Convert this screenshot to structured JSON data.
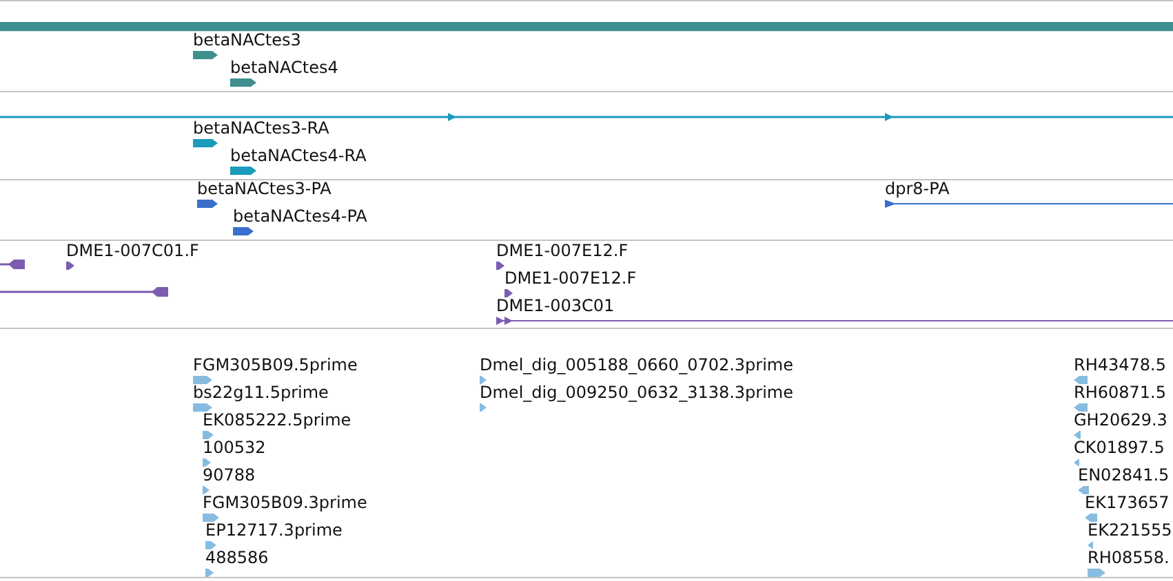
{
  "tracks": [
    {
      "color": "#3f8f8f",
      "features": [
        {
          "kind": "bar"
        },
        {
          "kind": "block",
          "label": "betaNACtes3",
          "reverse": false
        },
        {
          "kind": "block",
          "label": "betaNACtes4",
          "reverse": false
        }
      ]
    },
    {
      "color": "#1a9bbb",
      "features": [
        {
          "kind": "line",
          "reverse": false
        },
        {
          "kind": "block",
          "label": "betaNACtes3-RA",
          "reverse": false
        },
        {
          "kind": "block",
          "label": "betaNACtes4-RA",
          "reverse": false
        }
      ]
    },
    {
      "color": "#3a6fcc",
      "features": [
        {
          "kind": "block",
          "label": "betaNACtes3-PA",
          "reverse": false
        },
        {
          "kind": "block",
          "label": "betaNACtes4-PA",
          "reverse": false
        },
        {
          "kind": "block",
          "label": "dpr8-PA",
          "reverse": false
        }
      ]
    },
    {
      "color": "#7b5cb0",
      "features": [
        {
          "kind": "line",
          "reverse": true
        },
        {
          "kind": "block",
          "label": "DME1-007C01.F",
          "reverse": false
        },
        {
          "kind": "line",
          "reverse": true
        },
        {
          "kind": "block",
          "label": "DME1-007E12.F",
          "reverse": false
        },
        {
          "kind": "block",
          "label": "DME1-007E12.F",
          "reverse": false
        },
        {
          "kind": "block",
          "label": "DME1-003C01",
          "reverse": false
        }
      ]
    },
    {
      "color": "#88bbe0",
      "features": [
        {
          "kind": "block",
          "label": "FGM305B09.5prime",
          "reverse": false
        },
        {
          "kind": "block",
          "label": "bs22g11.5prime",
          "reverse": false
        },
        {
          "kind": "block",
          "label": "EK085222.5prime",
          "reverse": false
        },
        {
          "kind": "block",
          "label": "100532",
          "reverse": false
        },
        {
          "kind": "block",
          "label": "90788",
          "reverse": false
        },
        {
          "kind": "block",
          "label": "FGM305B09.3prime",
          "reverse": false
        },
        {
          "kind": "block",
          "label": "EP12717.3prime",
          "reverse": false
        },
        {
          "kind": "block",
          "label": "488586",
          "reverse": false
        },
        {
          "kind": "block",
          "label": "Dmel_dig_005188_0660_0702.3prime",
          "reverse": false
        },
        {
          "kind": "block",
          "label": "Dmel_dig_009250_0632_3138.3prime",
          "reverse": false
        },
        {
          "kind": "block",
          "label": "RH43478.5",
          "reverse": true
        },
        {
          "kind": "block",
          "label": "RH60871.5",
          "reverse": true
        },
        {
          "kind": "block",
          "label": "GH20629.3",
          "reverse": true
        },
        {
          "kind": "block",
          "label": "CK01897.5",
          "reverse": true
        },
        {
          "kind": "block",
          "label": "EN02841.5",
          "reverse": true
        },
        {
          "kind": "block",
          "label": "EK173657",
          "reverse": true
        },
        {
          "kind": "block",
          "label": "EK221555",
          "reverse": true
        },
        {
          "kind": "block",
          "label": "RH08558.",
          "reverse": false
        }
      ]
    }
  ]
}
